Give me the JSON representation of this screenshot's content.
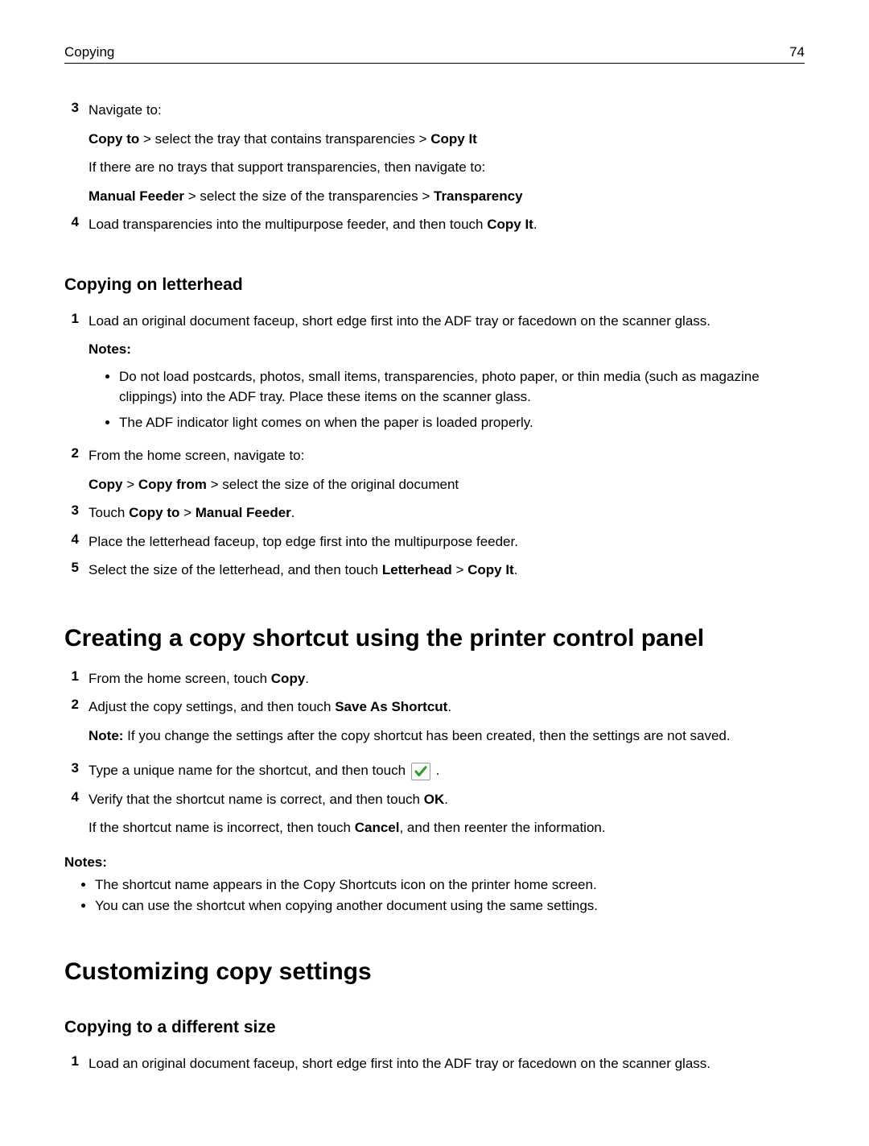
{
  "header": {
    "section": "Copying",
    "page": "74"
  },
  "pre_steps": [
    {
      "num": "3",
      "lines": [
        {
          "t": "text",
          "v": "Navigate to:"
        },
        {
          "t": "rich",
          "parts": [
            {
              "b": true,
              "v": "Copy to"
            },
            {
              "b": false,
              "v": " > select the tray that contains transparencies > "
            },
            {
              "b": true,
              "v": "Copy It"
            }
          ]
        },
        {
          "t": "text",
          "v": "If there are no trays that support transparencies, then navigate to:"
        },
        {
          "t": "rich",
          "parts": [
            {
              "b": true,
              "v": "Manual Feeder"
            },
            {
              "b": false,
              "v": " > select the size of the transparencies > "
            },
            {
              "b": true,
              "v": "Transparency"
            }
          ]
        }
      ]
    },
    {
      "num": "4",
      "lines": [
        {
          "t": "rich",
          "parts": [
            {
              "b": false,
              "v": "Load transparencies into the multipurpose feeder, and then touch "
            },
            {
              "b": true,
              "v": "Copy It"
            },
            {
              "b": false,
              "v": "."
            }
          ]
        }
      ]
    }
  ],
  "h_letterhead": "Copying on letterhead",
  "letterhead_steps": {
    "s1": {
      "num": "1",
      "line": "Load an original document faceup, short edge first into the ADF tray or facedown on the scanner glass.",
      "notes_label": "Notes:",
      "notes": [
        "Do not load postcards, photos, small items, transparencies, photo paper, or thin media (such as magazine clippings) into the ADF tray. Place these items on the scanner glass.",
        "The ADF indicator light comes on when the paper is loaded properly."
      ]
    },
    "s2": {
      "num": "2",
      "line": "From the home screen, navigate to:",
      "rich": [
        {
          "b": true,
          "v": "Copy"
        },
        {
          "b": false,
          "v": " > "
        },
        {
          "b": true,
          "v": "Copy from"
        },
        {
          "b": false,
          "v": " > select the size of the original document"
        }
      ]
    },
    "s3": {
      "num": "3",
      "rich": [
        {
          "b": false,
          "v": "Touch "
        },
        {
          "b": true,
          "v": "Copy to"
        },
        {
          "b": false,
          "v": " > "
        },
        {
          "b": true,
          "v": "Manual Feeder"
        },
        {
          "b": false,
          "v": "."
        }
      ]
    },
    "s4": {
      "num": "4",
      "line": "Place the letterhead faceup, top edge first into the multipurpose feeder."
    },
    "s5": {
      "num": "5",
      "rich": [
        {
          "b": false,
          "v": "Select the size of the letterhead, and then touch "
        },
        {
          "b": true,
          "v": "Letterhead"
        },
        {
          "b": false,
          "v": " > "
        },
        {
          "b": true,
          "v": "Copy It"
        },
        {
          "b": false,
          "v": "."
        }
      ]
    }
  },
  "h_shortcut": "Creating a copy shortcut using the printer control panel",
  "shortcut_steps": {
    "s1": {
      "num": "1",
      "rich": [
        {
          "b": false,
          "v": "From the home screen, touch "
        },
        {
          "b": true,
          "v": "Copy"
        },
        {
          "b": false,
          "v": "."
        }
      ]
    },
    "s2": {
      "num": "2",
      "rich": [
        {
          "b": false,
          "v": "Adjust the copy settings, and then touch "
        },
        {
          "b": true,
          "v": "Save As Shortcut"
        },
        {
          "b": false,
          "v": "."
        }
      ],
      "note_label": "Note:",
      "note_text": " If you change the settings after the copy shortcut has been created, then the settings are not saved."
    },
    "s3": {
      "num": "3",
      "pre": "Type a unique name for the shortcut, and then touch ",
      "post": "."
    },
    "s4": {
      "num": "4",
      "rich": [
        {
          "b": false,
          "v": "Verify that the shortcut name is correct, and then touch "
        },
        {
          "b": true,
          "v": "OK"
        },
        {
          "b": false,
          "v": "."
        }
      ],
      "line2": [
        {
          "b": false,
          "v": "If the shortcut name is incorrect, then touch "
        },
        {
          "b": true,
          "v": "Cancel"
        },
        {
          "b": false,
          "v": ", and then reenter the information."
        }
      ]
    }
  },
  "shortcut_notes_label": "Notes:",
  "shortcut_notes": [
    "The shortcut name appears in the Copy Shortcuts icon on the printer home screen.",
    "You can use the shortcut when copying another document using the same settings."
  ],
  "h_custom": "Customizing copy settings",
  "h_diff": "Copying to a different size",
  "diff_steps": {
    "s1": {
      "num": "1",
      "line": "Load an original document faceup, short edge first into the ADF tray or facedown on the scanner glass."
    }
  }
}
